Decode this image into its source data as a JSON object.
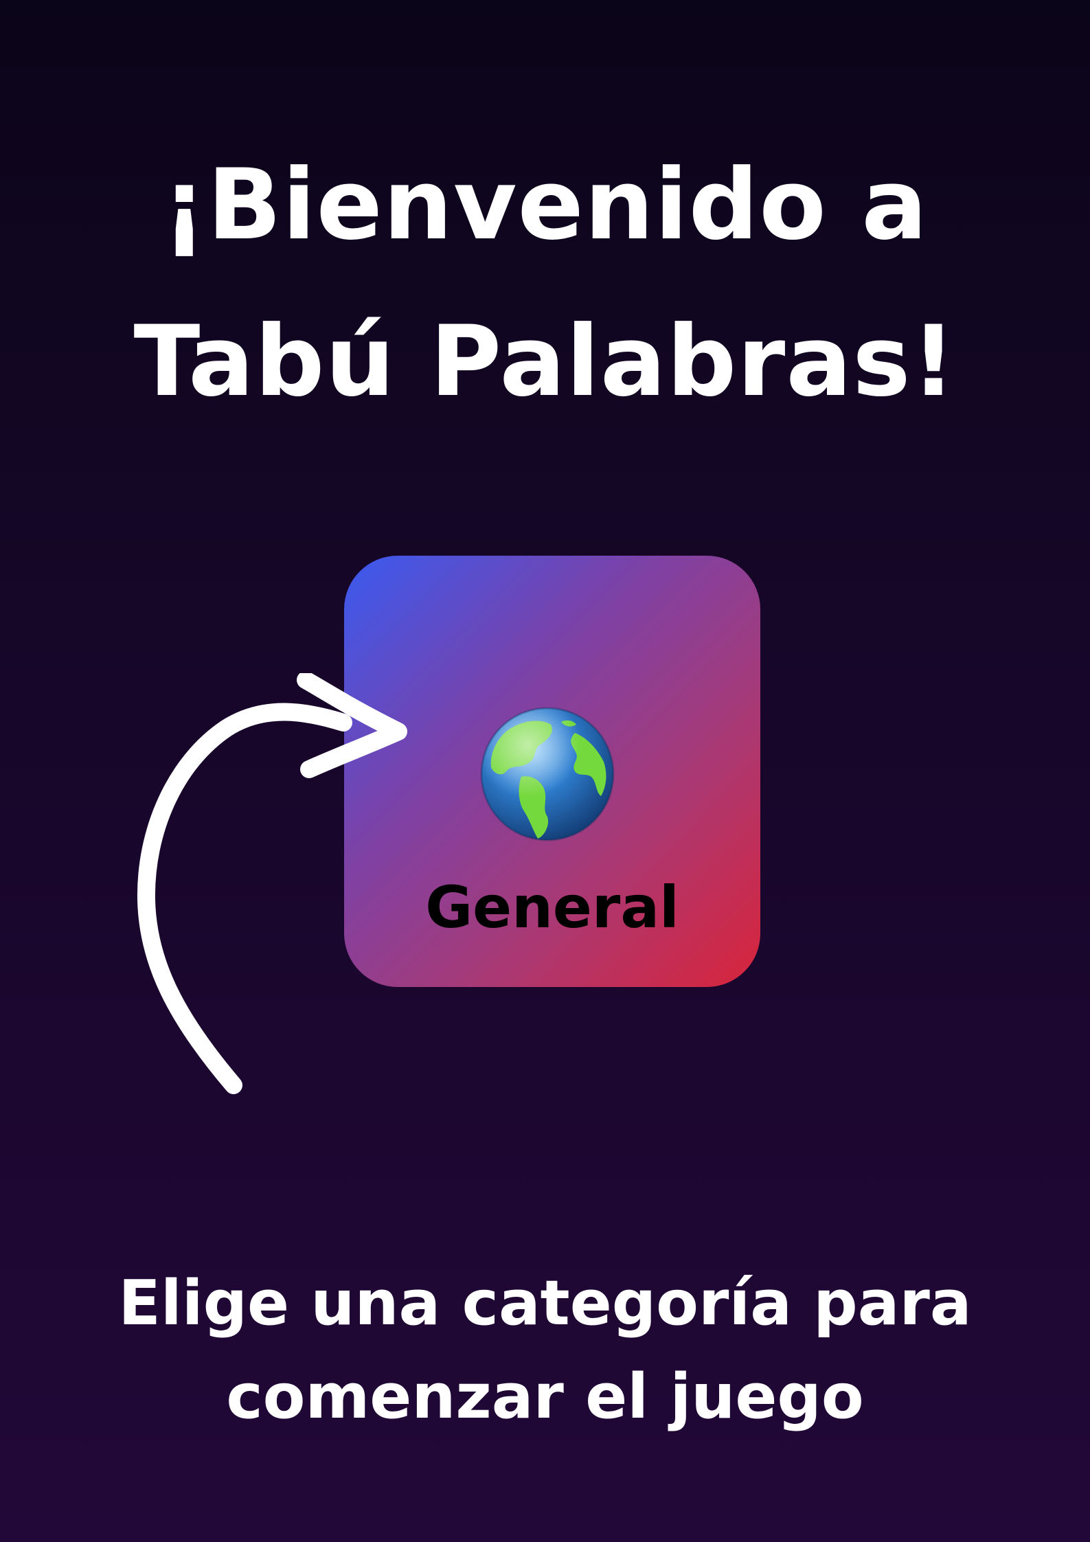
{
  "title": {
    "line1": "¡Bienvenido a",
    "line2": "Tabú Palabras!"
  },
  "category": {
    "label": "General",
    "icon": "globe-icon"
  },
  "subtitle": {
    "line1": "Elige una categoría para",
    "line2": "comenzar el juego"
  },
  "colors": {
    "background_top": "#0b0519",
    "background_bottom": "#220838",
    "card_gradient_start": "#3a5af0",
    "card_gradient_end": "#d9243a",
    "text": "#ffffff",
    "card_text": "#000000"
  }
}
